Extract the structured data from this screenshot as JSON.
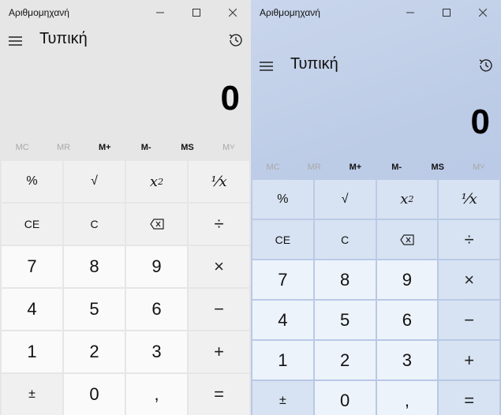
{
  "app": {
    "title": "Αριθμομηχανή",
    "mode": "Τυπική",
    "display": "0"
  },
  "memory": [
    "MC",
    "MR",
    "M+",
    "M-",
    "MS",
    "M˅"
  ],
  "memory_disabled": [
    true,
    true,
    false,
    false,
    false,
    true
  ],
  "keys": {
    "percent": "%",
    "sqrt": "√",
    "square_base": "x",
    "square_exp": "2",
    "reciprocal": "⅟x",
    "ce": "CE",
    "c": "C",
    "divide": "÷",
    "seven": "7",
    "eight": "8",
    "nine": "9",
    "multiply": "×",
    "four": "4",
    "five": "5",
    "six": "6",
    "minus": "−",
    "one": "1",
    "two": "2",
    "three": "3",
    "plus": "+",
    "negate": "±",
    "zero": "0",
    "decimal": ",",
    "equals": "="
  },
  "colors": {
    "left_bg": "#e6e6e6",
    "right_bg": "#bccbe6"
  }
}
